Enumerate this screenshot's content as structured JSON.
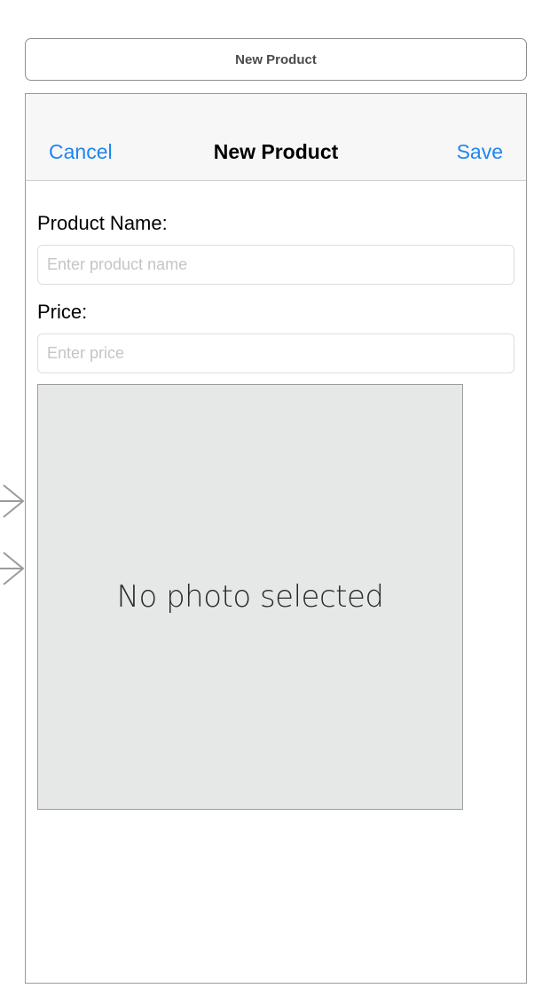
{
  "scene": {
    "title": "New Product"
  },
  "nav_bar": {
    "cancel_label": "Cancel",
    "title": "New Product",
    "save_label": "Save",
    "tint_color": "#1d86f0"
  },
  "form": {
    "name_label": "Product Name:",
    "name_value": "",
    "name_placeholder": "Enter product name",
    "price_label": "Price:",
    "price_value": "",
    "price_placeholder": "Enter price"
  },
  "photo": {
    "caption": "No photo selected",
    "background_color": "#e6e7e7"
  },
  "icons": {
    "segue_arrow": "chevron-right-icon"
  }
}
